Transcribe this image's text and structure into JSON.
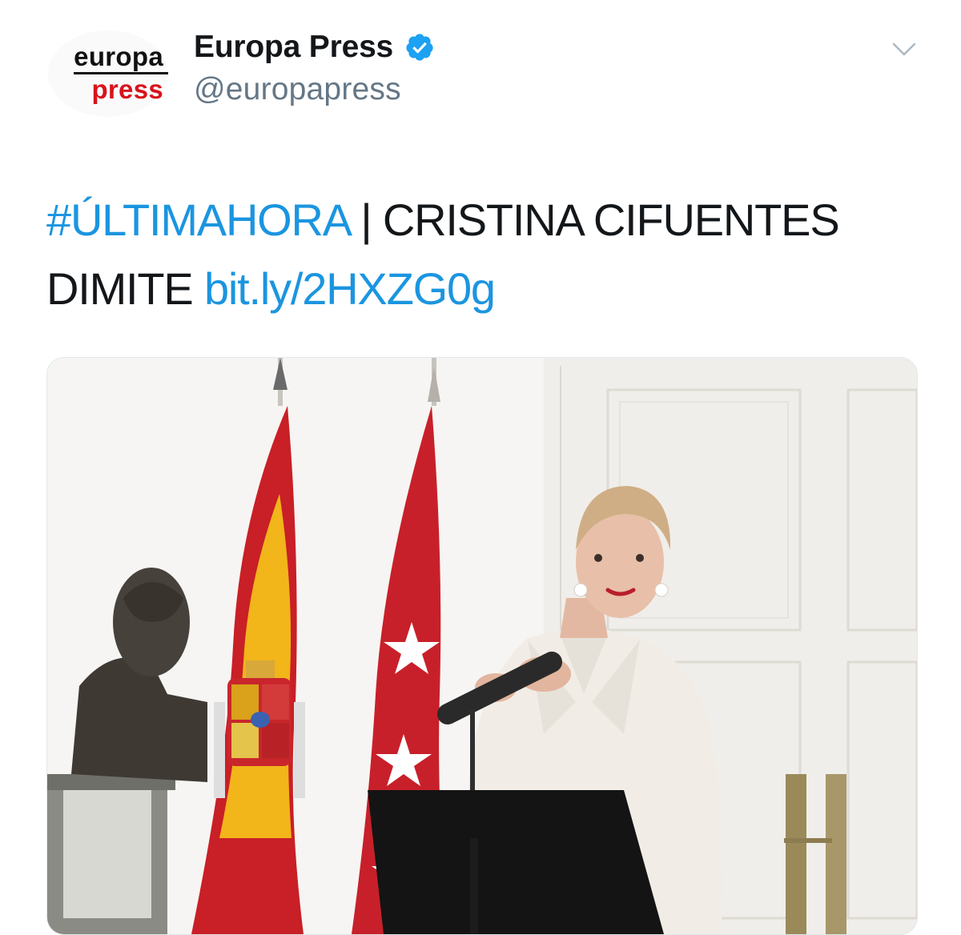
{
  "header": {
    "avatar": {
      "logo_top": "europa",
      "logo_bottom": "press",
      "logo_top_color": "#111111",
      "logo_bottom_color": "#d8131b"
    },
    "display_name": "Europa Press",
    "handle": "@europapress",
    "verified_icon": "verified-badge-icon",
    "menu_icon": "chevron-down-icon"
  },
  "tweet": {
    "hashtag": "#ÚLTIMAHORA",
    "text_part1": " | CRISTINA CIFUENTES DIMITE ",
    "link": "bit.ly/2HXZG0g",
    "link_color": "#1b95e0"
  },
  "media": {
    "type": "photo",
    "description_icon": "photo-icon"
  }
}
